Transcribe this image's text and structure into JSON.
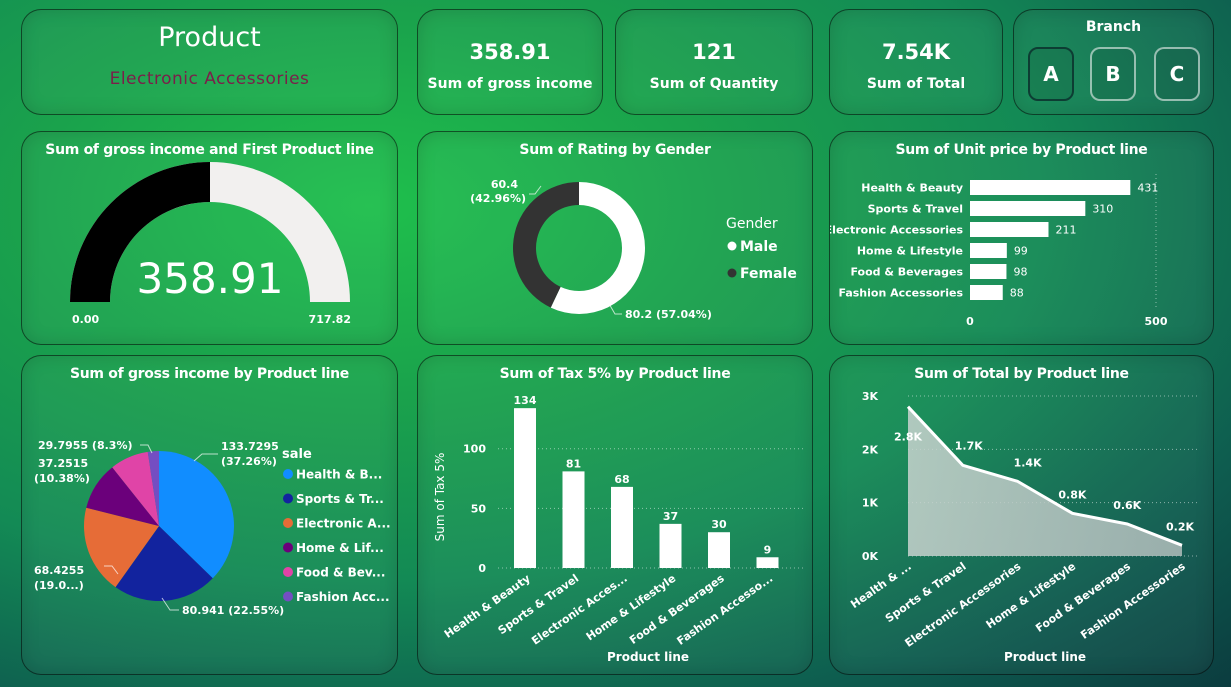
{
  "product_card": {
    "title": "Product",
    "subtitle": "Electronic Accessories",
    "subtitle_color": "#7b1f4a"
  },
  "kpis": [
    {
      "value": "358.91",
      "label": "Sum of gross income"
    },
    {
      "value": "121",
      "label": "Sum of Quantity"
    },
    {
      "value": "7.54K",
      "label": "Sum of Total"
    }
  ],
  "branch": {
    "title": "Branch",
    "options": [
      "A",
      "B",
      "C"
    ]
  },
  "colors": {
    "white": "#ffffff",
    "gauge_fill": "#000000",
    "gauge_rest": "#f2f0ef",
    "female": "#333333",
    "male": "#ffffff"
  },
  "chart_data": [
    {
      "type": "gauge",
      "title": "Sum of gross income and First Product line",
      "value": 358.91,
      "value_label": "358.91",
      "min": 0,
      "min_label": "0.00",
      "max": 717.82,
      "max_label": "717.82"
    },
    {
      "type": "donut",
      "title": "Sum of Rating by Gender",
      "legend_title": "Gender",
      "series": [
        {
          "name": "Male",
          "value": 80.2,
          "label": "80.2 (57.04%)",
          "color": "#ffffff"
        },
        {
          "name": "Female",
          "value": 60.4,
          "label": "60.4",
          "pct_label": "(42.96%)",
          "color": "#333333"
        }
      ]
    },
    {
      "type": "bar",
      "orientation": "horizontal",
      "title": "Sum of Unit price by Product line",
      "categories": [
        "Health & Beauty",
        "Sports & Travel",
        "Electronic Accessories",
        "Home & Lifestyle",
        "Food & Beverages",
        "Fashion Accessories"
      ],
      "values": [
        431,
        310,
        211,
        99,
        98,
        88
      ],
      "xlim": [
        0,
        500
      ],
      "x_ticks": [
        "0",
        "500"
      ]
    },
    {
      "type": "pie",
      "title": "Sum of gross income by Product line",
      "legend_title": "sale",
      "slices": [
        {
          "name": "Health & B...",
          "value": 133.7295,
          "label": "133.7295",
          "pct_label": "(37.26%)",
          "color": "#118dff"
        },
        {
          "name": "Sports & Tr...",
          "value": 80.941,
          "label": "80.941 (22.55%)",
          "color": "#12239e"
        },
        {
          "name": "Electronic A...",
          "value": 68.4255,
          "label": "68.4255",
          "pct_label": "(19.0...)",
          "color": "#e66c37"
        },
        {
          "name": "Home & Lif...",
          "value": 37.2515,
          "label": "37.2515",
          "pct_label": "(10.38%)",
          "color": "#6b007b"
        },
        {
          "name": "Food & Bev...",
          "value": 29.7955,
          "label": "29.7955 (8.3%)",
          "color": "#e044a7"
        },
        {
          "name": "Fashion Acc...",
          "value": 8.6,
          "label": "",
          "color": "#744ec2"
        }
      ]
    },
    {
      "type": "bar",
      "orientation": "vertical",
      "title": "Sum of Tax 5% by Product line",
      "xlabel": "Product line",
      "ylabel": "Sum of Tax 5%",
      "categories": [
        "Health & Beauty",
        "Sports & Travel",
        "Electronic Acces...",
        "Home & Lifestyle",
        "Food & Beverages",
        "Fashion Accesso..."
      ],
      "values": [
        134,
        81,
        68,
        37,
        30,
        9
      ],
      "ylim": [
        0,
        140
      ],
      "y_ticks": [
        "0",
        "50",
        "100"
      ]
    },
    {
      "type": "area",
      "title": "Sum of Total by Product line",
      "xlabel": "Product line",
      "categories": [
        "Health & ...",
        "Sports & Travel",
        "Electronic Accessories",
        "Home & Lifestyle",
        "Food & Beverages",
        "Fashion Accessories"
      ],
      "values": [
        2800,
        1700,
        1400,
        800,
        600,
        200
      ],
      "value_labels": [
        "2.8K",
        "1.7K",
        "1.4K",
        "0.8K",
        "0.6K",
        "0.2K"
      ],
      "ylim": [
        0,
        3000
      ],
      "y_ticks": [
        "0K",
        "1K",
        "2K",
        "3K"
      ]
    }
  ]
}
